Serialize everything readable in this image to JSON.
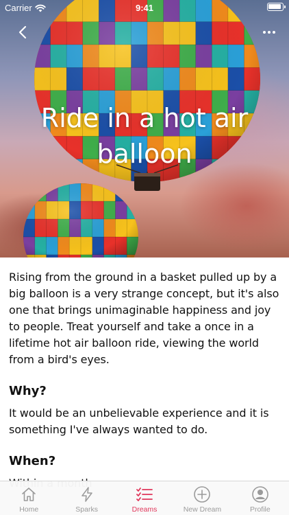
{
  "status_bar": {
    "carrier": "Carrier",
    "time": "9:41"
  },
  "hero": {
    "title": "Ride in a hot air balloon",
    "back_icon": "chevron-left-icon",
    "more_icon": "ellipsis-icon"
  },
  "content": {
    "description": "Rising from the ground in a basket pulled up by a big balloon is a very strange concept, but it's also one that brings unimaginable happiness and joy to people. Treat yourself and take a once in a lifetime hot air balloon ride, viewing the world from a bird's eyes.",
    "sections": [
      {
        "heading": "Why?",
        "text": "It would be an unbelievable experience and it is something I've always wanted to do."
      },
      {
        "heading": "When?",
        "text": "Within a month"
      }
    ]
  },
  "tabbar": {
    "active_color": "#e0365a",
    "inactive_color": "#9a9a9a",
    "tabs": [
      {
        "label": "Home",
        "icon": "home-icon"
      },
      {
        "label": "Sparks",
        "icon": "lightning-icon"
      },
      {
        "label": "Dreams",
        "icon": "checklist-icon"
      },
      {
        "label": "New Dream",
        "icon": "plus-circle-icon"
      },
      {
        "label": "Profile",
        "icon": "person-circle-icon"
      }
    ]
  }
}
